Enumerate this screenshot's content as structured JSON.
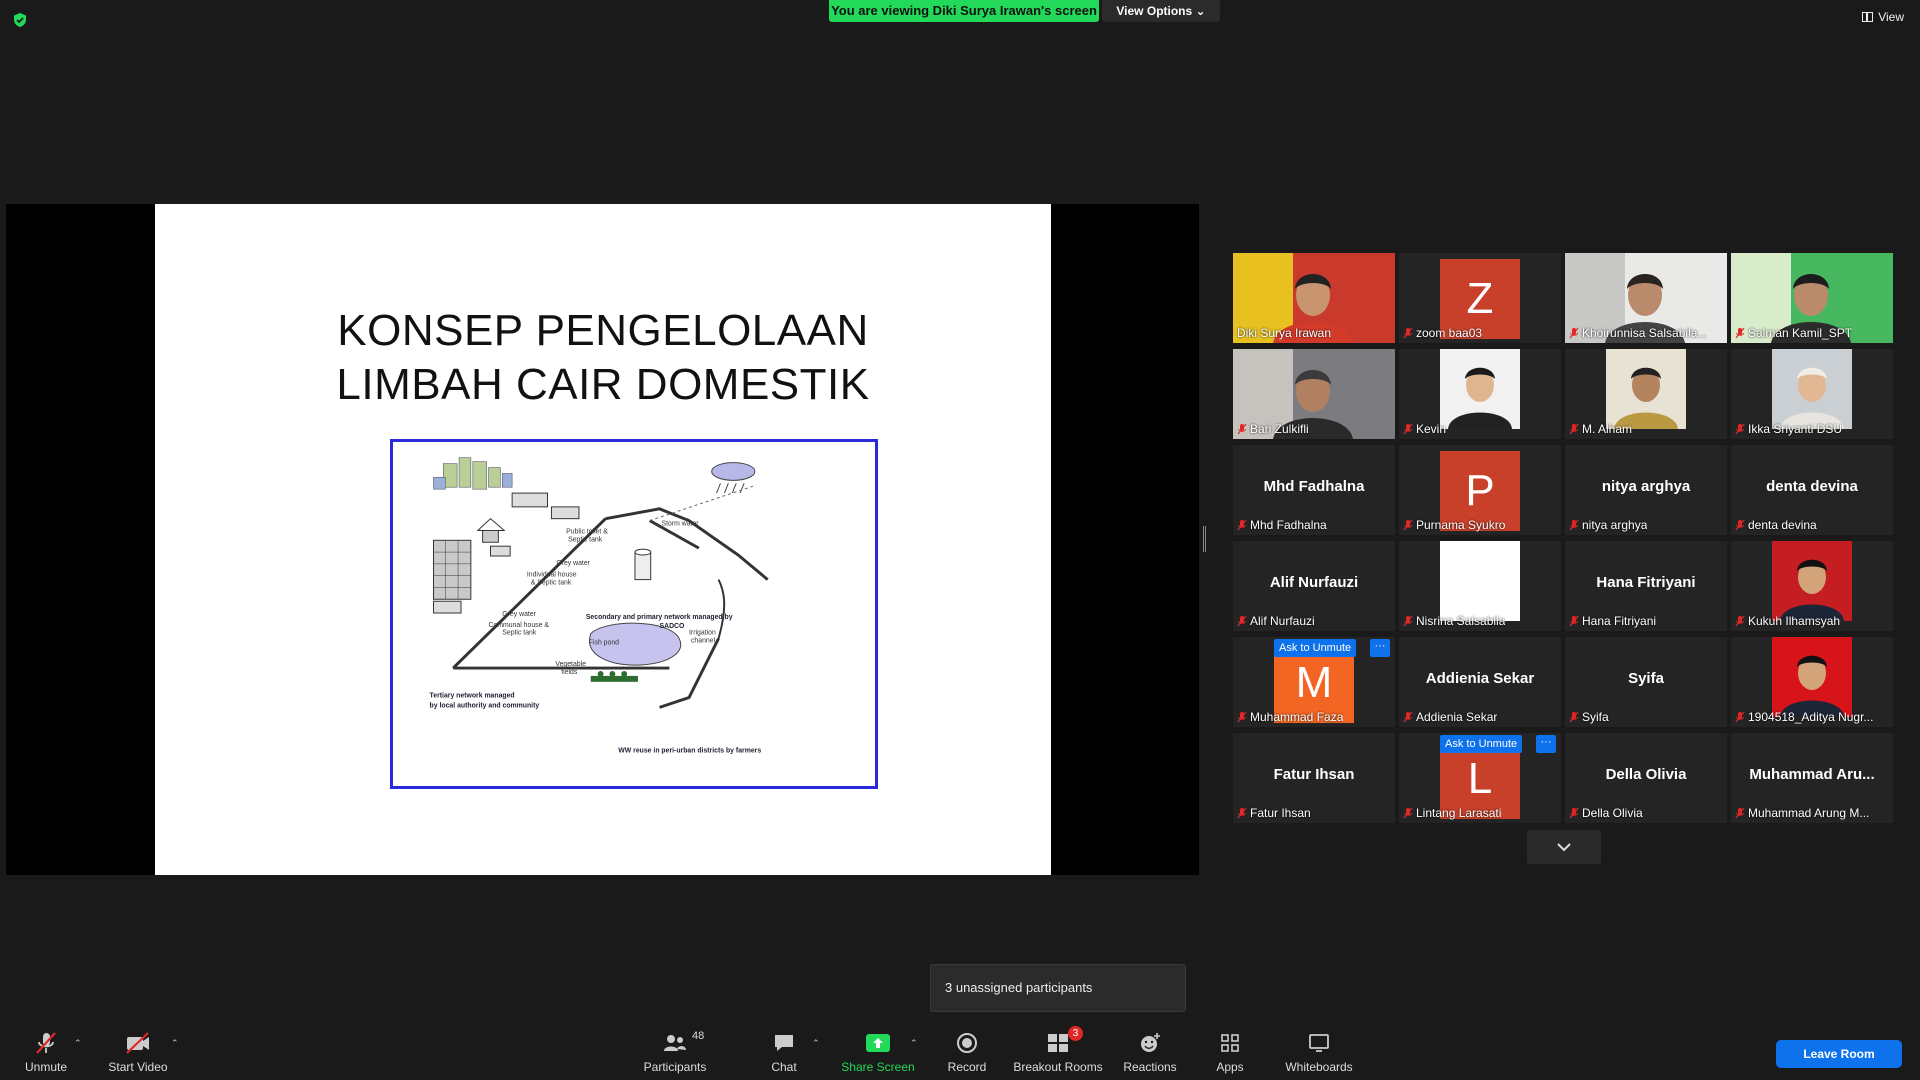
{
  "banner": {
    "viewing": "You are viewing Diki Surya Irawan's screen",
    "view_options": "View Options",
    "view": "View"
  },
  "slide": {
    "title_line1": "KONSEP PENGELOLAAN",
    "title_line2": "LIMBAH CAIR DOMESTIK",
    "diagram_labels": {
      "storm": "Storm water",
      "public_toilet": "Public toilet &",
      "public_toilet2": "Septic tank",
      "grey1": "Grey water",
      "individual": "Individual house",
      "individual2": "& Septic tank",
      "grey2": "Grey water",
      "communal": "Communal house &",
      "communal2": "Septic tank",
      "secondary": "Secondary and primary network managed by",
      "secondary2": "SADCO",
      "tertiary": "Tertiary network managed",
      "tertiary2": "by local authority and community",
      "fishpond": "Fish pond",
      "irrigation": "Irrigation",
      "irrigation2": "channel",
      "vegetable": "Vegetable",
      "vegetable2": "fields",
      "reuse": "WW reuse in peri-urban districts by farmers"
    }
  },
  "participants": [
    {
      "name": "Diki Surya Irawan",
      "type": "video",
      "active": true,
      "muted": false
    },
    {
      "name": "zoom baa03",
      "type": "letter",
      "letter": "Z",
      "color": "#c9402a",
      "muted": true
    },
    {
      "name": "Khoirunnisa Salsabila...",
      "type": "video",
      "muted": true
    },
    {
      "name": "Salman Kamil_SPT",
      "type": "video",
      "muted": true
    },
    {
      "name": "Bari Zulkifli",
      "type": "video",
      "muted": true
    },
    {
      "name": "Kevin",
      "type": "photo",
      "muted": true
    },
    {
      "name": "M. Alham",
      "type": "photo",
      "muted": true
    },
    {
      "name": "Ikka Sriyanti DSU",
      "type": "photo",
      "muted": true
    },
    {
      "name": "Mhd Fadhalna",
      "type": "text",
      "big": "Mhd Fadhalna",
      "muted": true
    },
    {
      "name": "Purnama Syukro",
      "type": "letter",
      "letter": "P",
      "color": "#c9402a",
      "muted": true
    },
    {
      "name": "nitya arghya",
      "type": "text",
      "big": "nitya arghya",
      "muted": true
    },
    {
      "name": "denta devina",
      "type": "text",
      "big": "denta devina",
      "muted": true
    },
    {
      "name": "Alif Nurfauzi",
      "type": "text",
      "big": "Alif Nurfauzi",
      "muted": true
    },
    {
      "name": "Nisrina Salsabila",
      "type": "white",
      "muted": true
    },
    {
      "name": "Hana Fitriyani",
      "type": "text",
      "big": "Hana Fitriyani",
      "muted": true
    },
    {
      "name": "Kukuh Ilhamsyah",
      "type": "photo",
      "muted": true
    },
    {
      "name": "Muhammad Faza",
      "type": "letter",
      "letter": "M",
      "color": "#f26522",
      "muted": true,
      "ask": true
    },
    {
      "name": "Addienia Sekar",
      "type": "text",
      "big": "Addienia Sekar",
      "muted": true
    },
    {
      "name": "Syifa",
      "type": "text",
      "big": "Syifa",
      "muted": true
    },
    {
      "name": "1904518_Aditya Nugr...",
      "type": "photo",
      "muted": true
    },
    {
      "name": "Fatur Ihsan",
      "type": "text",
      "big": "Fatur Ihsan",
      "muted": true
    },
    {
      "name": "Lintang Larasati",
      "type": "letter",
      "letter": "L",
      "color": "#c9402a",
      "muted": true,
      "ask": true
    },
    {
      "name": "Della Olivia",
      "type": "text",
      "big": "Della Olivia",
      "muted": true
    },
    {
      "name": "Muhammad Arung M...",
      "type": "text",
      "big": "Muhammad  Aru...",
      "muted": true
    }
  ],
  "ask_unmute_label": "Ask to Unmute",
  "more_label": "···",
  "tooltip": "3 unassigned participants",
  "toolbar": {
    "unmute": "Unmute",
    "start_video": "Start Video",
    "participants": "Participants",
    "participants_count": "48",
    "chat": "Chat",
    "share": "Share Screen",
    "record": "Record",
    "breakout": "Breakout Rooms",
    "breakout_badge": "3",
    "reactions": "Reactions",
    "apps": "Apps",
    "whiteboards": "Whiteboards",
    "leave": "Leave Room"
  },
  "colors": {
    "share_green": "#23d959",
    "accent_blue": "#0e72ed",
    "active_speaker": "#f4e64a",
    "mute_red": "#e02828"
  }
}
